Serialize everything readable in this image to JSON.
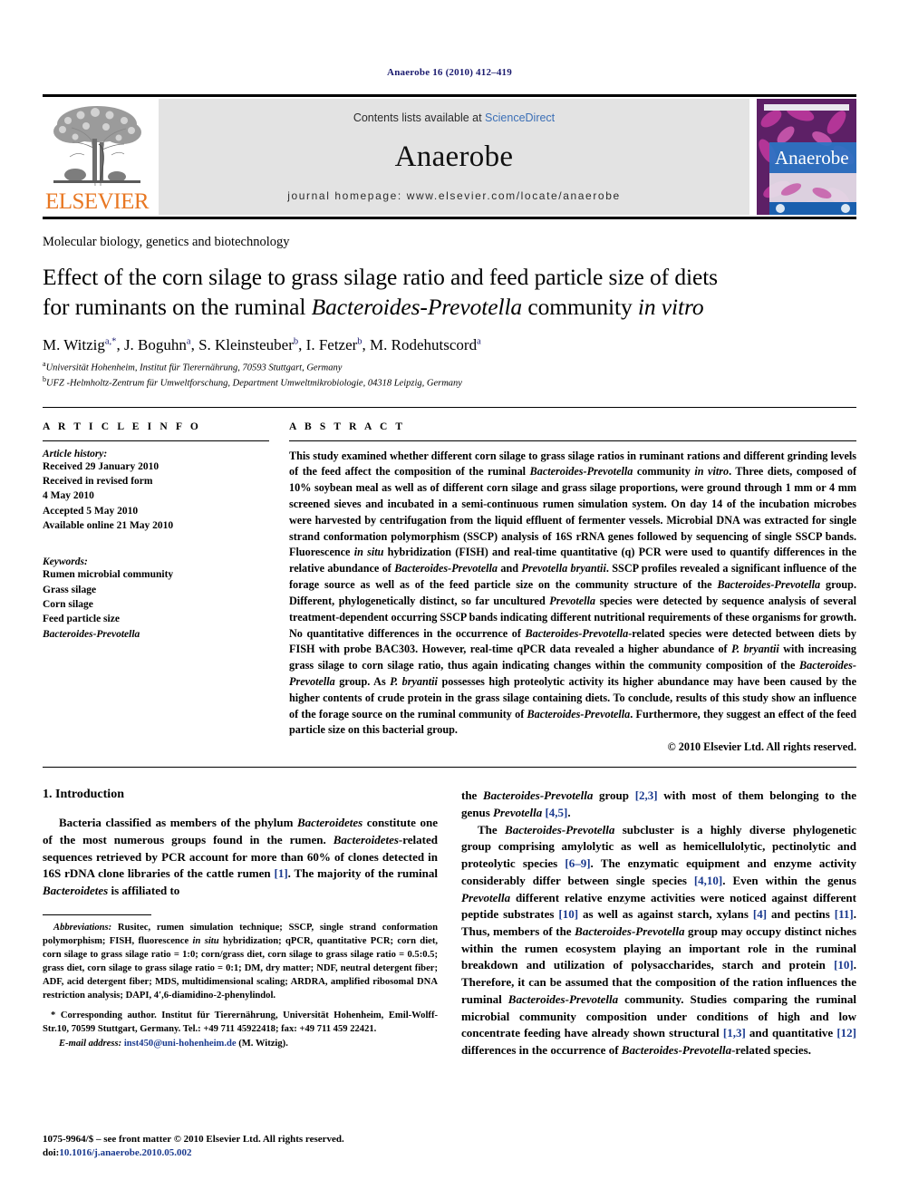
{
  "running_head": "Anaerobe 16 (2010) 412–419",
  "masthead": {
    "contents_prefix": "Contents lists available at ",
    "sciencedirect": "ScienceDirect",
    "journal_name": "Anaerobe",
    "homepage": "journal homepage: www.elsevier.com/locate/anaerobe",
    "publisher": "ELSEVIER",
    "cover_title": "Anaerobe",
    "colors": {
      "sciencedirect_blue": "#3b6fb6",
      "elsevier_orange": "#E87722",
      "masthead_grey": "#e3e3e3"
    }
  },
  "article": {
    "section_label": "Molecular biology, genetics and biotechnology",
    "title_line1": "Effect of the corn silage to grass silage ratio and feed particle size of diets",
    "title_line2_a": "for ruminants on the ruminal ",
    "title_line2_it": "Bacteroides-Prevotella",
    "title_line2_b": " community ",
    "title_line2_it2": "in vitro",
    "authors": "M. Witzig a,*, J. Boguhn a, S. Kleinsteuber b, I. Fetzer b, M. Rodehutscord a",
    "affiliation_a": "Universität Hohenheim, Institut für Tierernährung, 70593 Stuttgart, Germany",
    "affiliation_b": "UFZ -Helmholtz-Zentrum für Umweltforschung, Department Umweltmikrobiologie, 04318 Leipzig, Germany"
  },
  "info": {
    "heading": "A R T I C L E   I N F O",
    "history_title": "Article history:",
    "history": [
      "Received 29 January 2010",
      "Received in revised form",
      "4 May 2010",
      "Accepted 5 May 2010",
      "Available online 21 May 2010"
    ],
    "keywords_title": "Keywords:",
    "keywords": [
      "Rumen microbial community",
      "Grass silage",
      "Corn silage",
      "Feed particle size"
    ],
    "keyword_italic": "Bacteroides-Prevotella"
  },
  "abstract": {
    "heading": "A B S T R A C T",
    "p1_a": "This study examined whether different corn silage to grass silage ratios in ruminant rations and different grinding levels of the feed affect the composition of the ruminal ",
    "p1_it1": "Bacteroides-Prevotella",
    "p1_b": " community ",
    "p1_it2": "in vitro",
    "p1_c": ". Three diets, composed of 10% soybean meal as well as of different corn silage and grass silage proportions, were ground through 1 mm or 4 mm screened sieves and incubated in a semi-continuous rumen simulation system. On day 14 of the incubation microbes were harvested by centrifugation from the liquid effluent of fermenter vessels. Microbial DNA was extracted for single strand conformation polymorphism (SSCP) analysis of 16S rRNA genes followed by sequencing of single SSCP bands. Fluorescence ",
    "p1_it3": "in situ",
    "p1_d": " hybridization (FISH) and real-time quantitative (q) PCR were used to quantify differences in the relative abundance of ",
    "p1_it4": "Bacteroides-Prevotella",
    "p1_e": " and ",
    "p1_it5": "Prevotella bryantii",
    "p1_f": ". SSCP profiles revealed a significant influence of the forage source as well as of the feed particle size on the community structure of the ",
    "p1_it6": "Bacteroides-Prevotella",
    "p1_g": " group. Different, phylogenetically distinct, so far uncultured ",
    "p1_it7": "Prevotella",
    "p1_h": " species were detected by sequence analysis of several treatment-dependent occurring SSCP bands indicating different nutritional requirements of these organisms for growth. No quantitative differences in the occurrence of ",
    "p1_it8": "Bacteroides-Prevotella",
    "p1_i": "-related species were detected between diets by FISH with probe BAC303. However, real-time qPCR data revealed a higher abundance of ",
    "p1_it9": "P. bryantii",
    "p1_j": " with increasing grass silage to corn silage ratio, thus again indicating changes within the community composition of the ",
    "p1_it10": "Bacteroides-Prevotella",
    "p1_k": " group. As ",
    "p1_it11": "P. bryantii",
    "p1_l": " possesses high proteolytic activity its higher abundance may have been caused by the higher contents of crude protein in the grass silage containing diets. To conclude, results of this study show an influence of the forage source on the ruminal community of ",
    "p1_it12": "Bacteroides-Prevotella",
    "p1_m": ". Furthermore, they suggest an effect of the feed particle size on this bacterial group.",
    "copyright": "© 2010 Elsevier Ltd. All rights reserved."
  },
  "introduction": {
    "heading": "1. Introduction",
    "left_p1_a": "Bacteria classified as members of the phylum ",
    "left_p1_it1": "Bacteroidetes",
    "left_p1_b": " constitute one of the most numerous groups found in the rumen. ",
    "left_p1_it2": "Bacteroidetes",
    "left_p1_c": "-related sequences retrieved by PCR account for more than 60% of clones detected in 16S rDNA clone libraries of the cattle rumen ",
    "left_p1_ref1": "[1]",
    "left_p1_d": ". The majority of the ruminal ",
    "left_p1_it3": "Bacteroidetes",
    "left_p1_e": " is affiliated to",
    "right_p1_a": "the ",
    "right_p1_it1": "Bacteroides-Prevotella",
    "right_p1_b": " group ",
    "right_p1_ref1": "[2,3]",
    "right_p1_c": " with most of them belonging to the genus ",
    "right_p1_it2": "Prevotella",
    "right_p1_d": " ",
    "right_p1_ref2": "[4,5]",
    "right_p1_e": ".",
    "right_p2_a": "The ",
    "right_p2_it1": "Bacteroides-Prevotella",
    "right_p2_b": " subcluster is a highly diverse phylogenetic group comprising amylolytic as well as hemicellulolytic, pectinolytic and proteolytic species ",
    "right_p2_ref1": "[6–9]",
    "right_p2_c": ". The enzymatic equipment and enzyme activity considerably differ between single species ",
    "right_p2_ref2": "[4,10]",
    "right_p2_d": ". Even within the genus ",
    "right_p2_it2": "Prevotella",
    "right_p2_e": " different relative enzyme activities were noticed against different peptide substrates ",
    "right_p2_ref3": "[10]",
    "right_p2_f": " as well as against starch, xylans ",
    "right_p2_ref4": "[4]",
    "right_p2_g": " and pectins ",
    "right_p2_ref5": "[11]",
    "right_p2_h": ". Thus, members of the ",
    "right_p2_it3": "Bacteroides-Prevotella",
    "right_p2_i": " group may occupy distinct niches within the rumen ecosystem playing an important role in the ruminal breakdown and utilization of polysaccharides, starch and protein ",
    "right_p2_ref6": "[10]",
    "right_p2_j": ". Therefore, it can be assumed that the composition of the ration influences the ruminal ",
    "right_p2_it4": "Bacteroides-Prevotella",
    "right_p2_k": " community. Studies comparing the ruminal microbial community composition under conditions of high and low concentrate feeding have already shown structural ",
    "right_p2_ref7": "[1,3]",
    "right_p2_l": " and quantitative ",
    "right_p2_ref8": "[12]",
    "right_p2_m": " differences in the occurrence of ",
    "right_p2_it5": "Bacteroides-Prevotella",
    "right_p2_n": "-related species."
  },
  "footnotes": {
    "abbrev_title": "Abbreviations:",
    "abbrev_body": " Rusitec, rumen simulation technique; SSCP, single strand conformation polymorphism; FISH, fluorescence ",
    "abbrev_it1": "in situ",
    "abbrev_body2": " hybridization; qPCR, quantitative PCR; corn diet, corn silage to grass silage ratio = 1:0; corn/grass diet, corn silage to grass silage ratio = 0.5:0.5; grass diet, corn silage to grass silage ratio = 0:1; DM, dry matter; NDF, neutral detergent fiber; ADF, acid detergent fiber; MDS, multidimensional scaling; ARDRA, amplified ribosomal DNA restriction analysis; DAPI, 4′,6-diamidino-2-phenylindol.",
    "corresponding": "* Corresponding author. Institut für Tierernährung, Universität Hohenheim, Emil-Wolff-Str.10, 70599 Stuttgart, Germany. Tel.: +49 711 45922418; fax: +49 711 459 22421.",
    "email_label": "E-mail address:",
    "email_link": "inst450@uni-hohenheim.de",
    "email_suffix": " (M. Witzig).",
    "issn_line": "1075-9964/$ – see front matter © 2010 Elsevier Ltd. All rights reserved.",
    "doi_prefix": "doi:",
    "doi": "10.1016/j.anaerobe.2010.05.002"
  }
}
